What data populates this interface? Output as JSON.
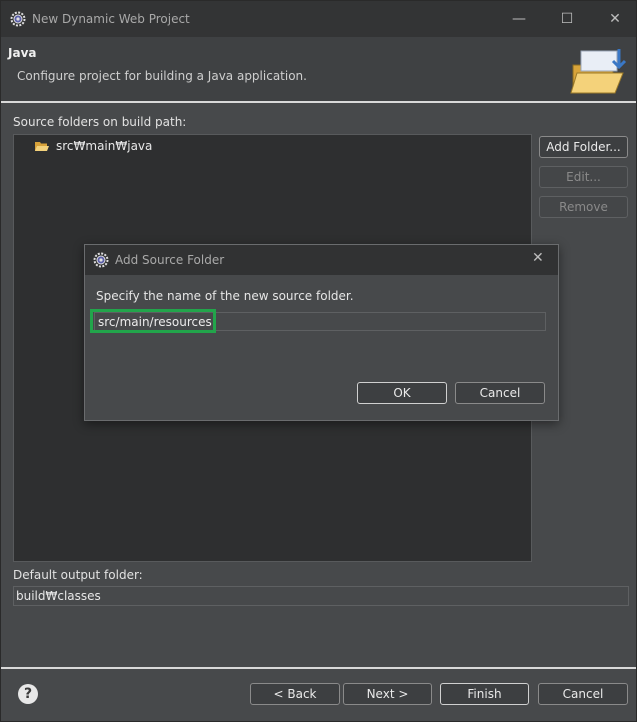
{
  "window": {
    "title": "New Dynamic Web Project",
    "controls": {
      "minimize": "—",
      "maximize": "☐",
      "close": "✕"
    }
  },
  "header": {
    "title": "Java",
    "description": "Configure project for building a Java application."
  },
  "source_folders": {
    "label": "Source folders on build path:",
    "items": [
      {
        "label": "src₩main₩java",
        "icon": "folder-open-icon"
      }
    ]
  },
  "side_buttons": {
    "add_folder": "Add Folder...",
    "edit": "Edit...",
    "remove": "Remove"
  },
  "output": {
    "label": "Default output folder:",
    "value": "build₩classes"
  },
  "footer": {
    "help": "?",
    "back": "< Back",
    "next": "Next >",
    "finish": "Finish",
    "cancel": "Cancel"
  },
  "dialog": {
    "title": "Add Source Folder",
    "close": "✕",
    "prompt": "Specify the name of the new source folder.",
    "input_value": "src/main/resources",
    "ok": "OK",
    "cancel": "Cancel"
  },
  "colors": {
    "highlight": "#22a54b",
    "background": "#47494b"
  }
}
